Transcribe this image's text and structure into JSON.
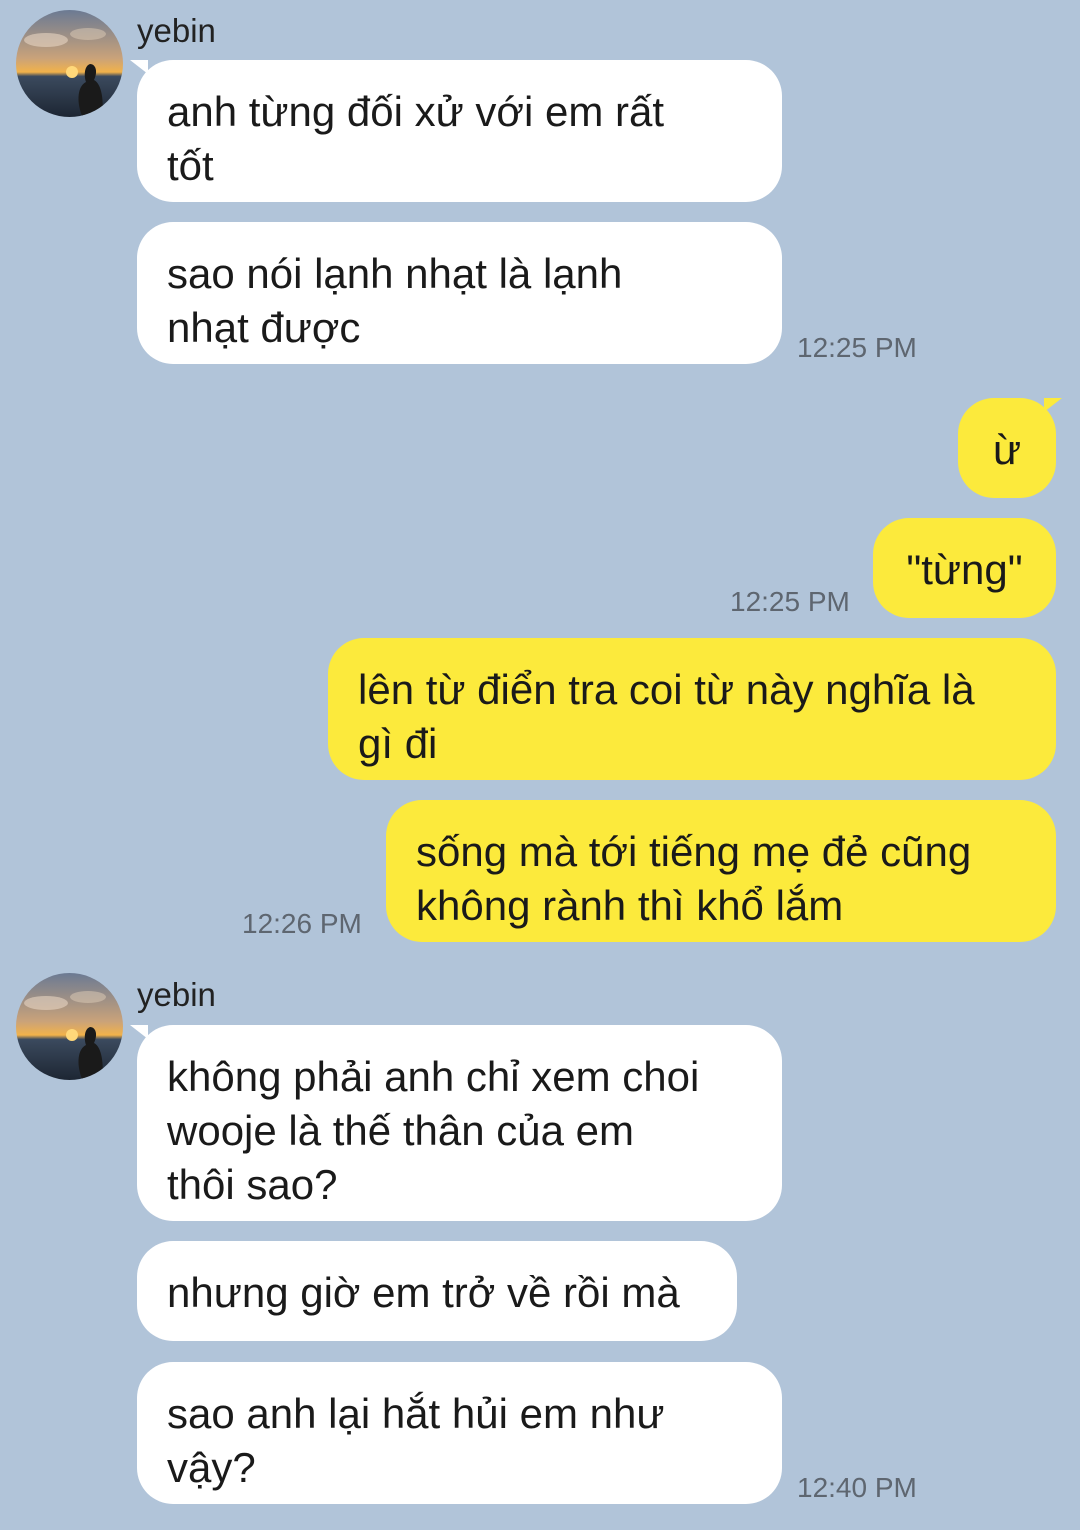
{
  "contact": {
    "name": "yebin",
    "avatar_icon": "sunset-silhouette-avatar-icon"
  },
  "colors": {
    "background": "#b1c4d9",
    "incoming_bubble": "#ffffff",
    "outgoing_bubble": "#fcea3c"
  },
  "messages": [
    {
      "from": "yebin",
      "text": "anh từng đối xử với em rất\ntốt"
    },
    {
      "from": "yebin",
      "text": "sao nói lạnh nhạt là lạnh\nnhạt được",
      "time": "12:25 PM"
    },
    {
      "from": "me",
      "text": "ừ"
    },
    {
      "from": "me",
      "text": "\"từng\"",
      "time": "12:25 PM"
    },
    {
      "from": "me",
      "text": "lên từ điển tra coi từ này nghĩa là\ngì đi"
    },
    {
      "from": "me",
      "text": "sống mà tới tiếng mẹ đẻ cũng\nkhông rành thì khổ lắm",
      "time": "12:26 PM"
    },
    {
      "from": "yebin",
      "text": "không phải anh chỉ xem choi\nwooje là thế thân của em\nthôi sao?"
    },
    {
      "from": "yebin",
      "text": "nhưng giờ em trở về rồi mà"
    },
    {
      "from": "yebin",
      "text": "sao anh lại hắt hủi em như\nvậy?",
      "time": "12:40 PM"
    }
  ]
}
